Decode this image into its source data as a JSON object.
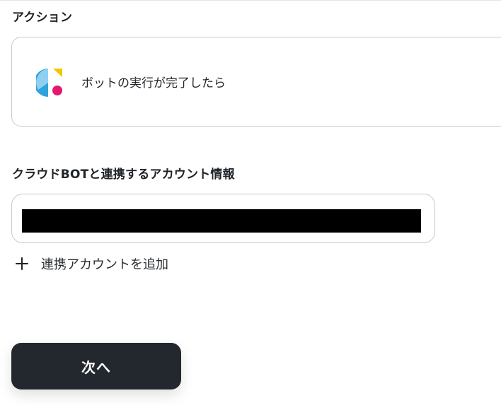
{
  "sections": {
    "action_label": "アクション",
    "account_label": "クラウドBOTと連携するアカウント情報"
  },
  "action": {
    "app_icon": "crowdbot-logo",
    "text": "ボットの実行が完了したら"
  },
  "account": {
    "value": "",
    "redacted": true
  },
  "add_account": {
    "icon": "plus-icon",
    "label": "連携アカウントを追加"
  },
  "next_button": {
    "label": "次へ"
  },
  "colors": {
    "button_bg": "#23282f",
    "border": "#c9c9cc",
    "logo_blue": "#2ea3dc",
    "logo_light_blue": "#8fd0f0",
    "logo_yellow": "#f5c400",
    "logo_magenta": "#e2196e"
  }
}
